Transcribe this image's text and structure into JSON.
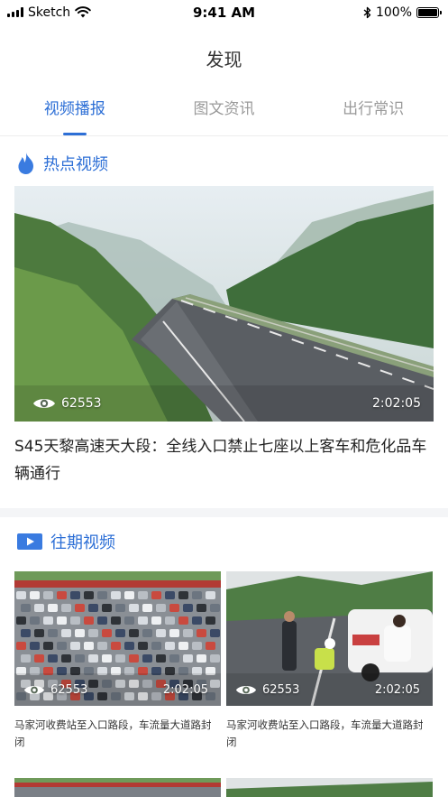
{
  "status_bar": {
    "carrier": "Sketch",
    "time": "9:41 AM",
    "battery": "100%",
    "battery_level": 1.0,
    "icons": [
      "signal-icon",
      "wifi-icon",
      "bluetooth-icon",
      "battery-icon"
    ]
  },
  "header": {
    "title": "发现"
  },
  "tabs": [
    {
      "label": "视频播报",
      "active": true
    },
    {
      "label": "图文资讯",
      "active": false
    },
    {
      "label": "出行常识",
      "active": false
    }
  ],
  "hot": {
    "heading": "热点视频",
    "icon": "flame-icon",
    "video": {
      "views": "62553",
      "duration": "2:02:05",
      "title": "S45天黎高速天大段：全线入口禁止七座以上客车和危化品车辆通行"
    }
  },
  "past": {
    "heading": "往期视频",
    "icon": "video-play-icon",
    "items": [
      {
        "views": "62553",
        "duration": "2:02:05",
        "title": "马家河收费站至入口路段，车流量大道路封闭"
      },
      {
        "views": "62553",
        "duration": "2:02:05",
        "title": "马家河收费站至入口路段，车流量大道路封闭"
      }
    ]
  },
  "colors": {
    "accent": "#2d6fd6",
    "band": "#f4f5f7",
    "inactive_tab": "#9a9a9a"
  }
}
